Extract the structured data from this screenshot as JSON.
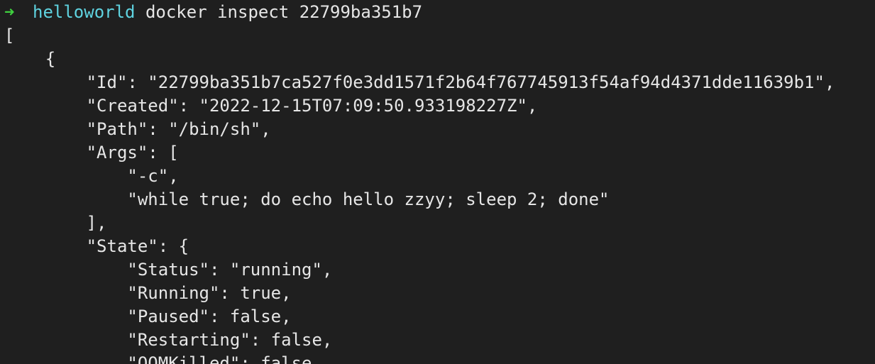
{
  "prompt": {
    "arrow": "➜",
    "cwd": "helloworld",
    "command": " docker inspect 22799ba351b7"
  },
  "output_lines": [
    "[",
    "    {",
    "        \"Id\": \"22799ba351b7ca527f0e3dd1571f2b64f767745913f54af94d4371dde11639b1\",",
    "        \"Created\": \"2022-12-15T07:09:50.933198227Z\",",
    "        \"Path\": \"/bin/sh\",",
    "        \"Args\": [",
    "            \"-c\",",
    "            \"while true; do echo hello zzyy; sleep 2; done\"",
    "        ],",
    "        \"State\": {",
    "            \"Status\": \"running\",",
    "            \"Running\": true,",
    "            \"Paused\": false,",
    "            \"Restarting\": false,",
    "            \"OOMKilled\": false,"
  ],
  "colors": {
    "background": "#1f1f1f",
    "text": "#e6e6e6",
    "prompt_arrow": "#3fd13f",
    "prompt_cwd": "#5fd3e0"
  }
}
